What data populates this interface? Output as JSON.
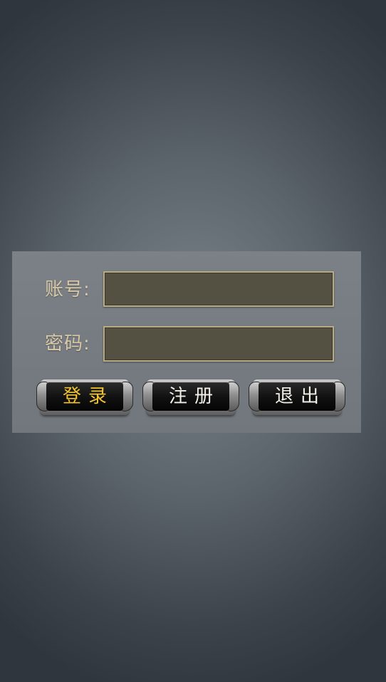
{
  "login_form": {
    "account_label": "账号:",
    "account_value": "",
    "password_label": "密码:",
    "password_value": ""
  },
  "buttons": {
    "login_label": "登录",
    "register_label": "注册",
    "exit_label": "退出"
  },
  "colors": {
    "label_text": "#d8c8a6",
    "login_text": "#f2c230",
    "button_text": "#f2efe8",
    "field_fill": "#545143",
    "field_border": "#b7ab85"
  }
}
